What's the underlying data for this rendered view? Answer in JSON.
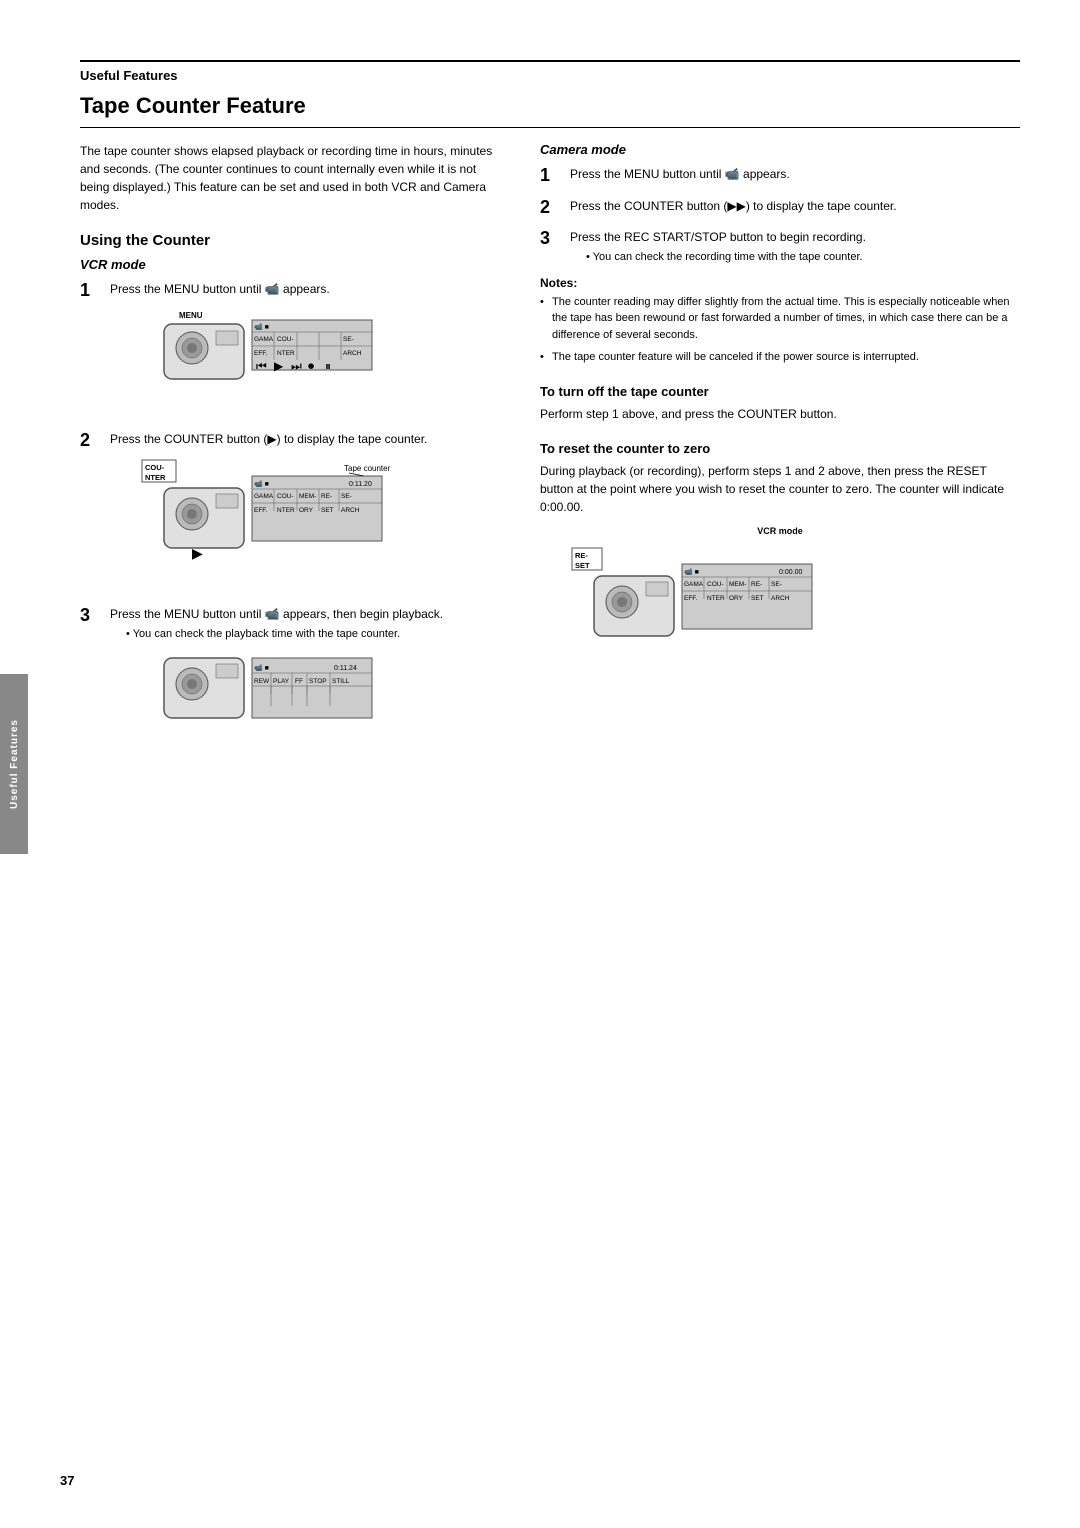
{
  "page": {
    "number": "37",
    "section": "Useful Features",
    "title": "Tape Counter Feature"
  },
  "intro": {
    "text": "The tape counter shows elapsed playback or recording time in hours, minutes and seconds. (The counter continues to count internally even while it is not being displayed.) This feature can be set and used in both VCR and Camera modes."
  },
  "side_tab": {
    "label": "Useful Features"
  },
  "using_counter": {
    "title": "Using the Counter",
    "vcr_mode": {
      "label": "VCR mode",
      "steps": [
        {
          "num": "1",
          "text": "Press the MENU button until ",
          "icon": "menu-icon",
          "suffix": " appears."
        },
        {
          "num": "2",
          "text": "Press the COUNTER button (",
          "icon": "ff-icon",
          "suffix": ") to display the tape counter."
        },
        {
          "num": "3",
          "text": "Press the MENU button until ",
          "icon": "menu-icon",
          "suffix": " appears, then begin playback.",
          "bullet": "You can check the playback time with the tape counter."
        }
      ]
    }
  },
  "camera_mode": {
    "label": "Camera mode",
    "steps": [
      {
        "num": "1",
        "text": "Press the MENU button until ",
        "icon": "menu-icon",
        "suffix": " appears."
      },
      {
        "num": "2",
        "text": "Press the COUNTER button (",
        "icon": "ff-icon",
        "suffix": ") to display the tape counter."
      },
      {
        "num": "3",
        "text": "Press the REC START/STOP button to begin recording.",
        "bullet": "You can check the recording time with the tape counter."
      }
    ]
  },
  "notes": {
    "title": "Notes:",
    "items": [
      "The counter reading may differ slightly from the actual time. This is especially noticeable when the tape has been rewound or fast forwarded a number of times, in which case there can be a difference of several seconds.",
      "The tape counter feature will be canceled if the power source is interrupted."
    ]
  },
  "turn_off": {
    "title": "To turn off the tape counter",
    "text": "Perform step 1 above, and press the COUNTER button."
  },
  "reset": {
    "title": "To reset the counter to zero",
    "text": "During playback (or recording), perform steps 1 and 2 above, then press the RESET button at the point where you wish to reset the counter to zero. The counter will indicate 0:00.00.",
    "vcr_mode_label": "VCR mode"
  },
  "diagrams": {
    "vcr1_menu": "MENU",
    "vcr1_screen": {
      "row1": [
        "GAMA",
        "COU-",
        "EFF.",
        "NTER",
        "",
        "SE-",
        "ARCH"
      ],
      "icons": "⏮ ▶ ⏭ ● ⏸"
    },
    "vcr2_screen": {
      "label": "Tape counter",
      "counter": "0:11.20",
      "row1": [
        "GAMA",
        "COU-",
        "MEM-",
        "RE-",
        "SE-"
      ],
      "row2": [
        "EFF.",
        "NTER",
        "ORY",
        "SET",
        "ARCH"
      ]
    },
    "vcr3_screen": {
      "counter": "0:11.24",
      "row1": [
        "REW",
        "PLAY",
        "FF",
        "STOP",
        "STILL"
      ]
    },
    "reset_screen": {
      "counter": "0:00.00",
      "row1": [
        "GAMA",
        "COU-",
        "MEM-",
        "RE-",
        "SE-"
      ],
      "row2": [
        "EFF.",
        "NTER",
        "ORY",
        "SET",
        "ARCH"
      ]
    }
  }
}
